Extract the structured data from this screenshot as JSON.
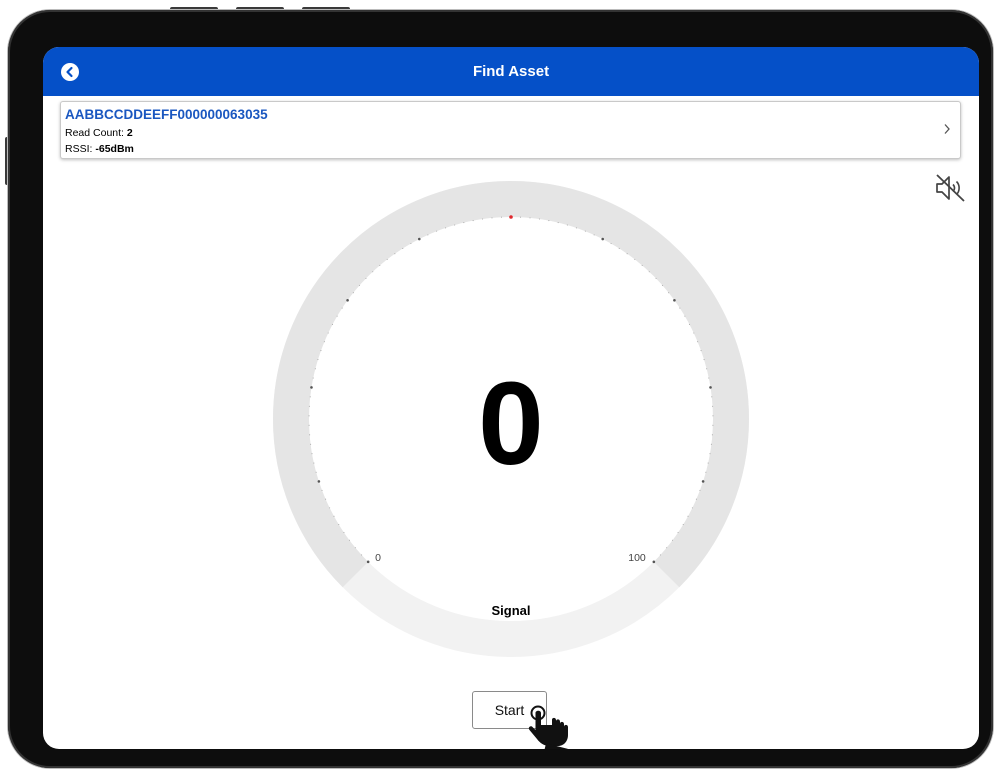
{
  "header": {
    "title": "Find Asset"
  },
  "asset": {
    "id": "AABBCCDDEEFF000000063035",
    "read_count_label": "Read Count:",
    "read_count": "2",
    "rssi_label": "RSSI:",
    "rssi": "-65dBm"
  },
  "gauge": {
    "value": "0",
    "min_label": "0",
    "max_label": "100",
    "caption": "Signal",
    "level": 0
  },
  "controls": {
    "start_label": "Start"
  },
  "colors": {
    "header_bg": "#0550c8",
    "asset_id": "#1a57c0",
    "indicator": "#e0282d"
  },
  "icons": {
    "back": "back-arrow-circle-icon",
    "chevron": "chevron-right-icon",
    "mute": "speaker-muted-icon",
    "cursor": "hand-pointer-icon"
  }
}
